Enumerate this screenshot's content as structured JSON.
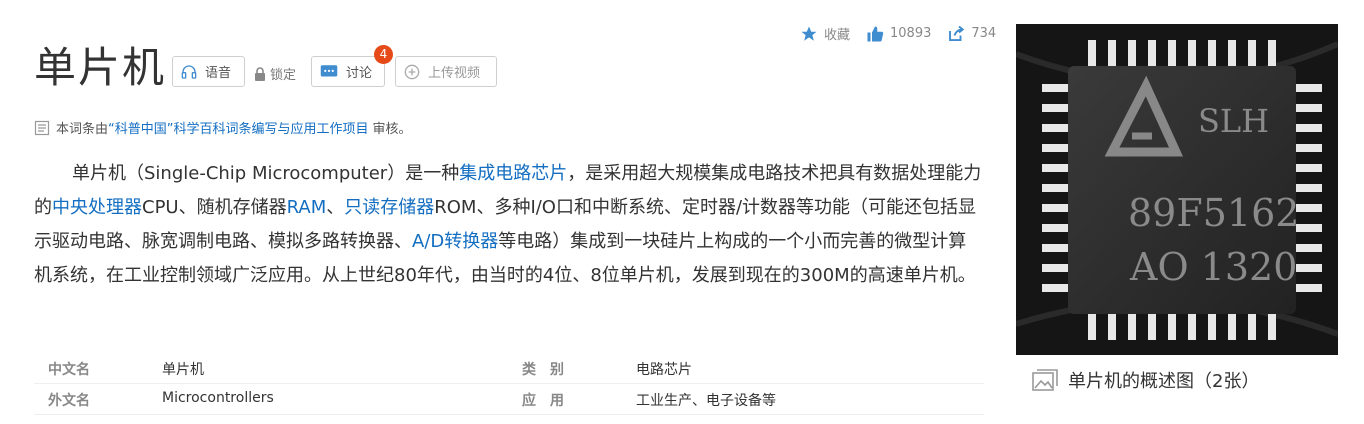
{
  "stats": {
    "favorite_label": "收藏",
    "likes": "10893",
    "shares": "734"
  },
  "title": "单片机",
  "buttons": {
    "voice": "语音",
    "lock": "锁定",
    "discuss": "讨论",
    "discuss_badge": "4",
    "upload_video": "上传视频"
  },
  "review": {
    "prefix": "本词条由",
    "org": "“科普中国”科学百科词条编写与应用工作项目",
    "suffix": "审核。"
  },
  "para": {
    "t1": "单片机（Single-Chip Microcomputer）是一种",
    "l1": "集成电路芯片",
    "t2": "，是采用超大规模集成电路技术把具有数据处理能力的",
    "l2": "中央处理器",
    "t3": "CPU、随机存储器",
    "l3": "RAM",
    "t4": "、",
    "l4": "只读存储器",
    "t5": "ROM、多种I/O口和中断系统、定时器/计数器等功能（可能还包括显示驱动电路、脉宽调制电路、模拟多路转换器、",
    "l5": "A/D转换器",
    "t6": "等电路）集成到一块硅片上构成的一个小而完善的微型计算机系统，在工业控制领域广泛应用。从上世纪80年代，由当时的4位、8位单片机，发展到现在的300M的高速单片机。"
  },
  "info": {
    "rows": [
      {
        "k1": "中文名",
        "v1": "单片机",
        "k2": "类　别",
        "v2": "电路芯片"
      },
      {
        "k1": "外文名",
        "v1": "Microcontrollers",
        "k2": "应　用",
        "v2": "工业生产、电子设备等"
      }
    ]
  },
  "image": {
    "chip_text": [
      "SLH",
      "89F5162",
      "AO 1320"
    ],
    "caption": "单片机的概述图（2张）"
  },
  "colors": {
    "link": "#136ec2",
    "badge": "#e64a19",
    "accent_icon": "#3f8ccf"
  }
}
